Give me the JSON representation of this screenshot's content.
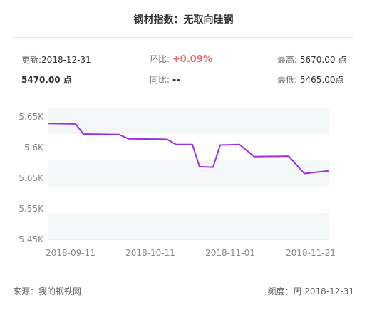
{
  "title": "钢材指数：无取向硅钢",
  "info": {
    "update_label": "更新:",
    "update_value": "2018-12-31",
    "huanbi_label": "环比:",
    "huanbi_value": "+0.09%",
    "high_label": "最高:",
    "high_value": "5670.00 点",
    "current_value": "5470.00 点",
    "tongbi_label": "同比:",
    "tongbi_value": "--",
    "low_label": "最低:",
    "low_value": "5465.00点"
  },
  "colors": {
    "line": "#9b30e3",
    "band": "#f4f7f8",
    "huanbi": "#f06b6b"
  },
  "chart_data": {
    "type": "line",
    "title": "",
    "xlabel": "",
    "ylabel": "",
    "y_tick_labels": [
      "5.65K",
      "5.6K",
      "5.65K",
      "5.55K",
      "5.45K"
    ],
    "x_tick_labels": [
      "2018-09-11",
      "2018-10-11",
      "2018-11-01",
      "2018-11-21"
    ],
    "series": [
      {
        "name": "",
        "values": [
          5670,
          5669,
          5650,
          5649,
          5641,
          5640,
          5630,
          5630,
          5588,
          5587,
          5629,
          5630,
          5607,
          5608,
          5575,
          5580
        ]
      }
    ],
    "ylim": [
      5450,
      5700
    ],
    "grid": "alternating bands"
  },
  "footer": {
    "source": "来源：我的钢铁网",
    "frequency": "频度：周 2018-12-31"
  }
}
